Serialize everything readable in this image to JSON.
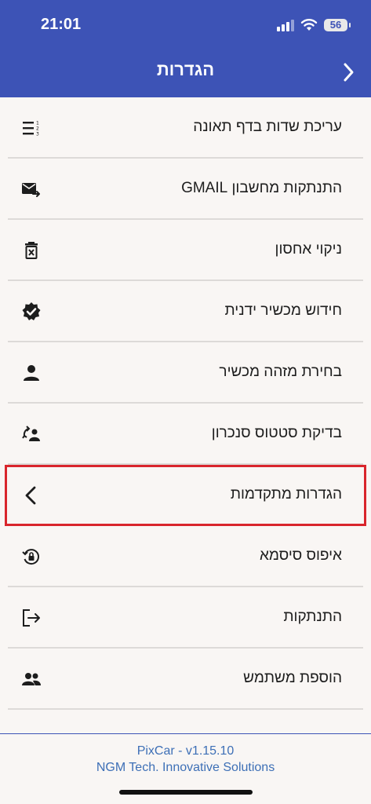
{
  "status_bar": {
    "time": "21:01",
    "battery": "56",
    "icons": [
      "signal-icon",
      "wifi-icon",
      "battery-icon"
    ]
  },
  "header": {
    "title": "הגדרות",
    "back_icon": "chevron-right-icon",
    "color": "#3d53b6"
  },
  "menu": [
    {
      "label": "עריכת שדות בדף תאונה",
      "icon": "numbered-list-icon"
    },
    {
      "label": "התנתקות מחשבון GMAIL",
      "icon": "mail-send-icon"
    },
    {
      "label": "ניקוי אחסון",
      "icon": "trash-icon"
    },
    {
      "label": "חידוש מכשיר ידנית",
      "icon": "verified-badge-icon"
    },
    {
      "label": "בחירת מזהה מכשיר",
      "icon": "person-icon"
    },
    {
      "label": "בדיקת סטטוס סנכרון",
      "icon": "sync-user-icon"
    },
    {
      "label": "הגדרות מתקדמות",
      "icon": "chevron-left-icon",
      "highlighted": true
    },
    {
      "label": "איפוס סיסמא",
      "icon": "lock-reset-icon"
    },
    {
      "label": "התנתקות",
      "icon": "logout-icon"
    },
    {
      "label": "הוספת משתמש",
      "icon": "group-icon"
    }
  ],
  "footer": {
    "line1": "PixCar - v1.15.10",
    "line2": "NGM Tech. Innovative Solutions"
  },
  "colors": {
    "accent": "#3d53b6",
    "highlight": "#d9252c",
    "footer_text": "#3d6fb6"
  }
}
